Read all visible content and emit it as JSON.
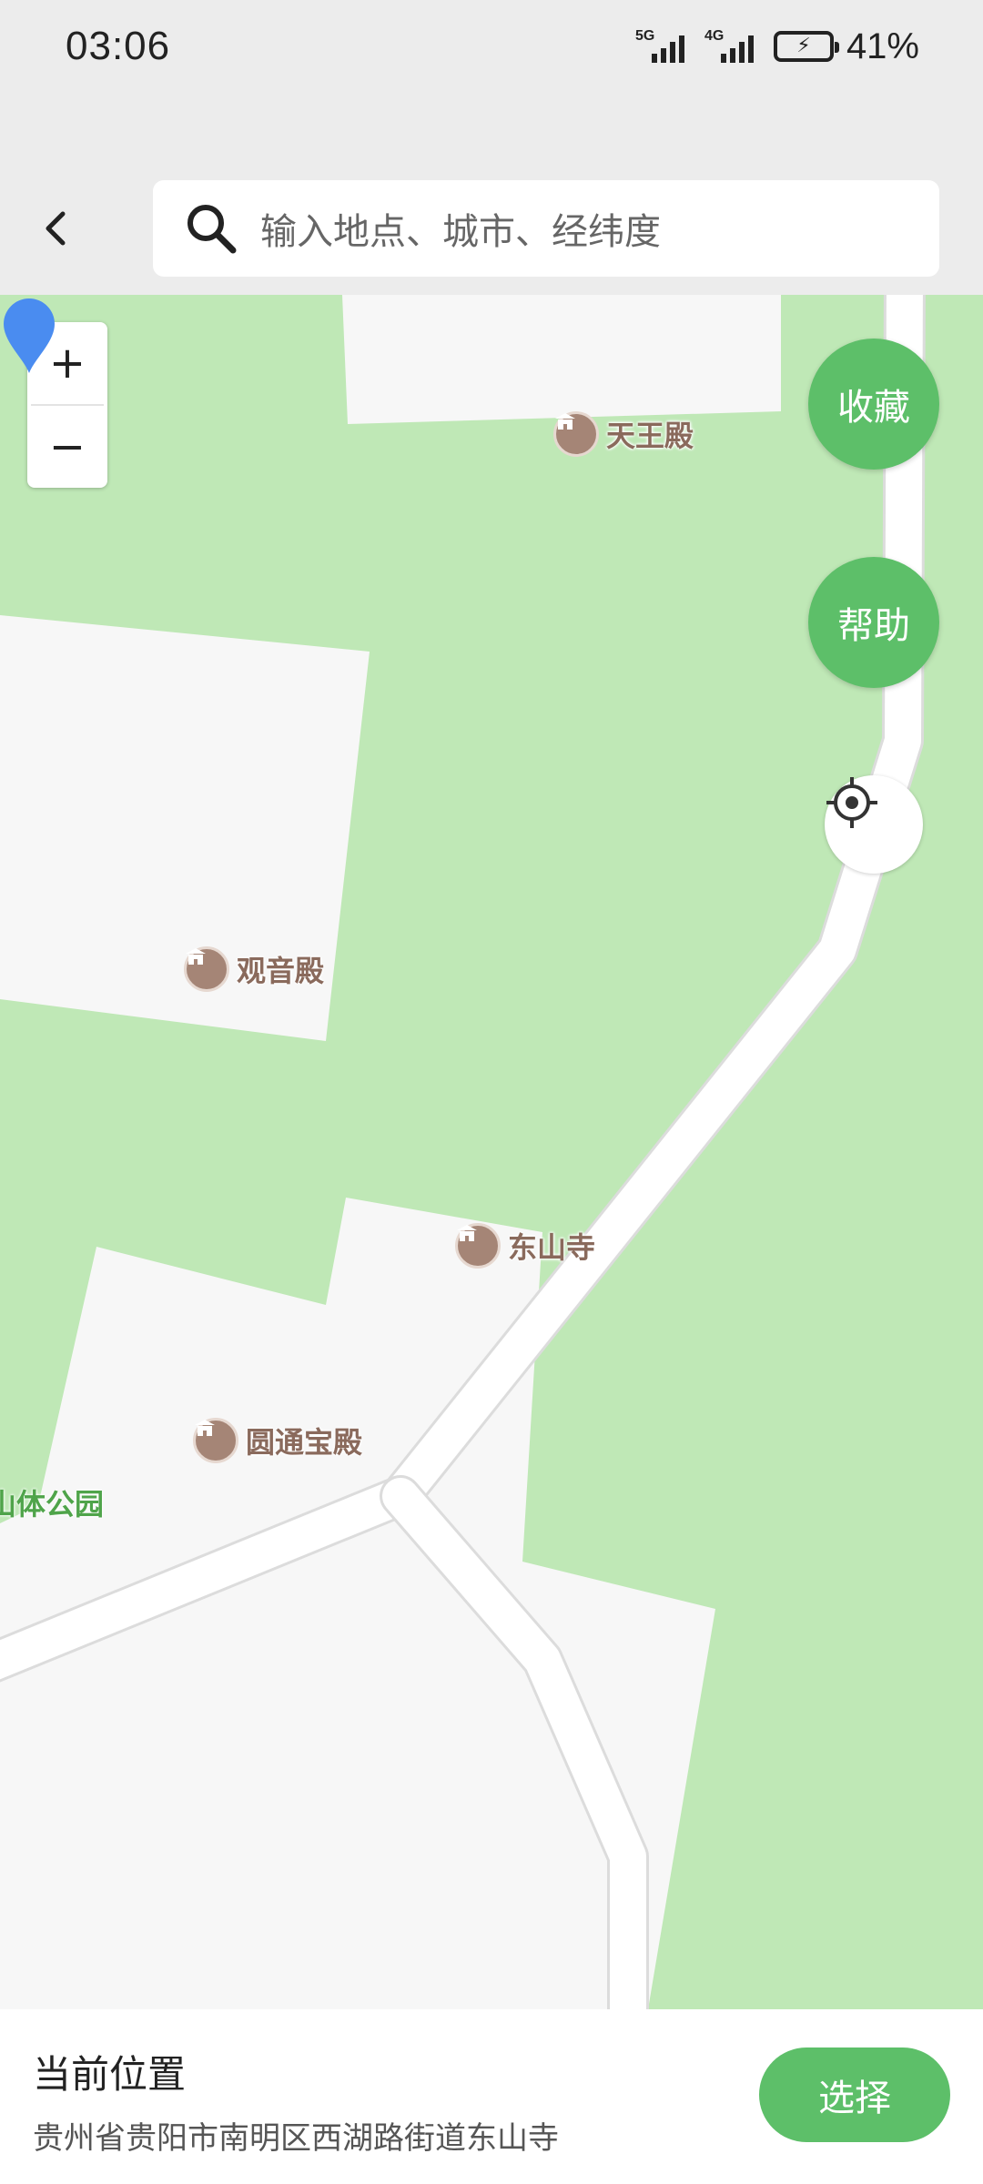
{
  "status_bar": {
    "time": "03:06",
    "network1": "5G",
    "network2": "4G",
    "battery": "41%"
  },
  "header": {
    "search_placeholder": "输入地点、城市、经纬度"
  },
  "map": {
    "zoom_in": "+",
    "zoom_out": "−",
    "favorite_label": "收藏",
    "help_label": "帮助",
    "pois": {
      "tianwang": "天王殿",
      "guanyin": "观音殿",
      "dongshan": "东山寺",
      "yuantong": "圆通宝殿"
    },
    "area_label": "山体公园",
    "colors": {
      "greenery": "#bfe8b6",
      "road": "#ffffff",
      "building": "#f7f7f7",
      "accent": "#5dbf69",
      "pin": "#4a8cf0"
    }
  },
  "bottom_panel": {
    "title": "当前位置",
    "address": "贵州省贵阳市南明区西湖路街道东山寺",
    "select_label": "选择"
  }
}
